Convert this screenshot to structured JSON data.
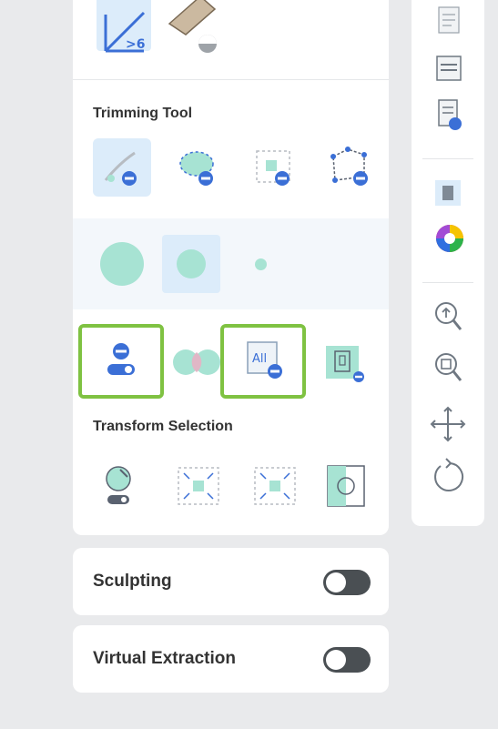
{
  "trimming_tool": {
    "title": "Trimming Tool",
    "tools": [
      {
        "icon": "lasso-trim-icon",
        "selected": true
      },
      {
        "icon": "smart-trim-icon",
        "selected": false
      },
      {
        "icon": "box-trim-icon",
        "selected": false
      },
      {
        "icon": "polygon-trim-icon",
        "selected": false
      }
    ]
  },
  "brush_sizes": [
    {
      "size": "large",
      "selected": false
    },
    {
      "size": "medium",
      "selected": true
    },
    {
      "size": "small",
      "selected": false
    }
  ],
  "actions": [
    {
      "icon": "remove-by-toggle-icon",
      "highlighted": true
    },
    {
      "icon": "overlap-icon",
      "highlighted": false
    },
    {
      "icon": "remove-all-icon",
      "highlighted": true,
      "label": "All"
    },
    {
      "icon": "remove-selection-icon",
      "highlighted": false
    }
  ],
  "transform_selection": {
    "title": "Transform Selection",
    "tools": [
      {
        "icon": "transform-toggle-icon"
      },
      {
        "icon": "shrink-selection-icon"
      },
      {
        "icon": "expand-selection-icon"
      },
      {
        "icon": "invert-selection-icon"
      }
    ]
  },
  "sculpting": {
    "label": "Sculpting",
    "enabled": false
  },
  "virtual_extraction": {
    "label": "Virtual Extraction",
    "enabled": false
  },
  "right_toolbar": [
    "report-icon",
    "list-icon",
    "document-settings-icon",
    "model-view-icon",
    "color-picker-icon",
    "zoom-in-icon",
    "zoom-fit-icon",
    "move-icon",
    "rotate-icon"
  ],
  "colors": {
    "accent_blue": "#3b6fd6",
    "teal": "#a7e3d3",
    "highlight_green": "#7fc242",
    "toggle_off": "#4a4f53"
  }
}
